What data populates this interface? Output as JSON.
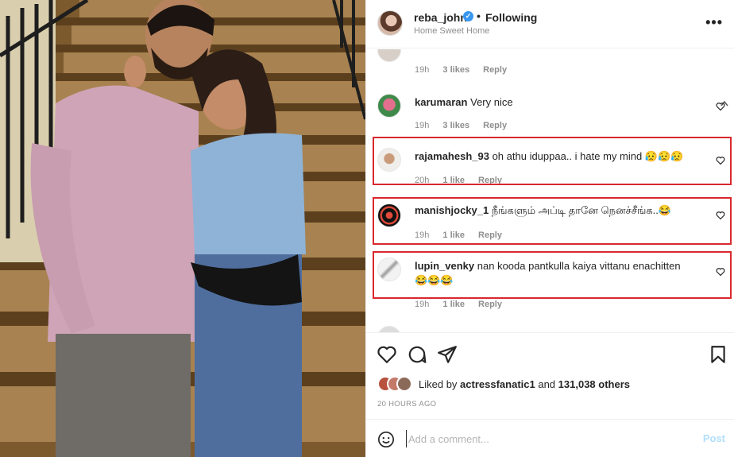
{
  "header": {
    "username": "reba_john",
    "separator": "•",
    "follow_status": "Following",
    "location": "Home Sweet Home",
    "more": "•••"
  },
  "comments": [
    {
      "username": "karumaran",
      "text": "Very nice",
      "time": "19h",
      "likes": "3 likes",
      "reply": "Reply",
      "highlighted": false
    },
    {
      "username": "rajamahesh_93",
      "text": "oh athu iduppaa.. i hate my mind 😥😥😥",
      "time": "20h",
      "likes": "1 like",
      "reply": "Reply",
      "highlighted": true
    },
    {
      "username": "manishjocky_1",
      "text": "நீங்களும் அப்டி தானே நெனச்சீங்க..😂",
      "time": "19h",
      "likes": "1 like",
      "reply": "Reply",
      "highlighted": true
    },
    {
      "username": "lupin_venky",
      "text": "nan kooda pantkulla kaiya vittanu enachitten 😂😂😂",
      "time": "19h",
      "likes": "1 like",
      "reply": "Reply",
      "highlighted": true
    }
  ],
  "top_partial_meta": {
    "time": "19h",
    "likes": "3 likes",
    "reply": "Reply"
  },
  "liked_by": {
    "prefix": "Liked by",
    "user": "actressfanatic1",
    "middle": "and",
    "others": "131,038 others"
  },
  "time_ago": "20 HOURS AGO",
  "add_comment": {
    "placeholder": "Add a comment...",
    "post_label": "Post"
  },
  "colors": {
    "highlight_border": "#d9282f",
    "post_disabled": "#b2dffc",
    "verified": "#3897f0",
    "meta_text": "#8e8e8e"
  },
  "icons": {
    "like": "heart-icon",
    "comment": "comment-icon",
    "share": "paper-plane-icon",
    "save": "bookmark-icon",
    "emoji": "smiley-icon",
    "more": "more-options-icon"
  }
}
